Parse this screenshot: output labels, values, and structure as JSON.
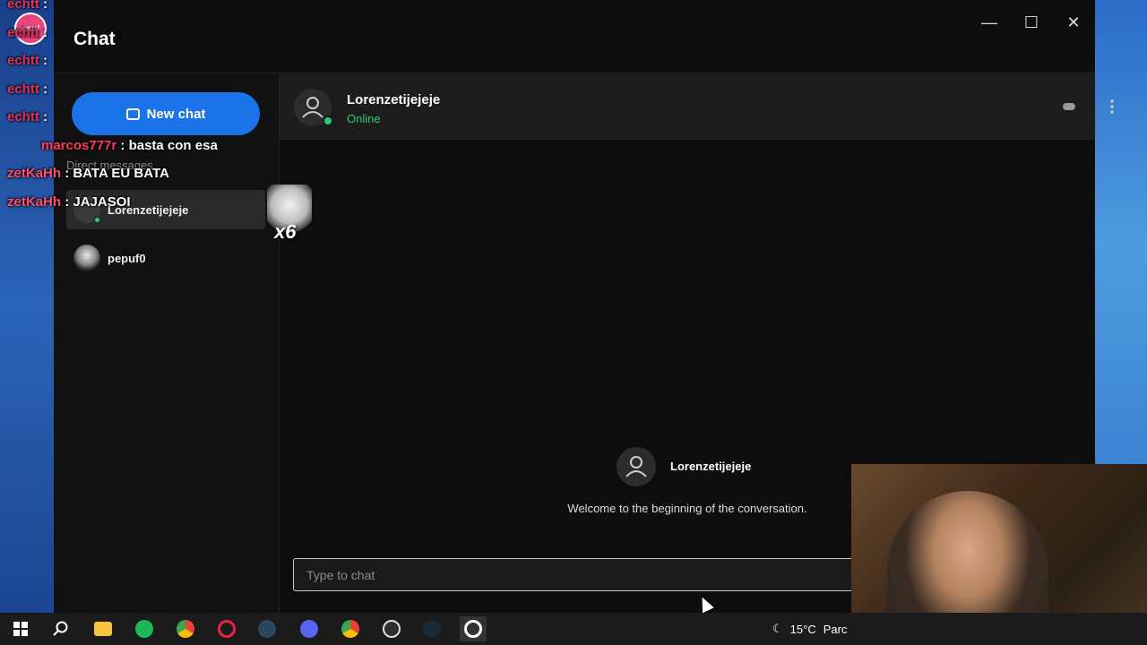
{
  "window": {
    "title": "Chat",
    "controls": {
      "minimize": "—",
      "maximize": "☐",
      "close": "✕"
    }
  },
  "sidebar": {
    "new_chat_label": "New chat",
    "section_heading": "Direct messages",
    "items": [
      {
        "name": "Lorenzetijejeje",
        "online": true,
        "active": true
      },
      {
        "name": "pepuf0",
        "online": false,
        "active": false
      }
    ]
  },
  "chat": {
    "contact_name": "Lorenzetijejeje",
    "contact_status": "Online",
    "welcome_name": "Lorenzetijejeje",
    "welcome_text": "Welcome to the beginning of the conversation.",
    "input_placeholder": "Type to chat",
    "input_value": ""
  },
  "stream_overlay": {
    "badge": "osu!",
    "lines": [
      {
        "user": "echtt",
        "message": ":"
      },
      {
        "user": "echtt",
        "message": ":"
      },
      {
        "user": "echtt",
        "message": ":"
      },
      {
        "user": "echtt",
        "message": ":"
      },
      {
        "user": "echtt",
        "message": ":"
      },
      {
        "user": "marcos777r",
        "message": ": basta con esa"
      },
      {
        "user": "zetKaHh",
        "message": ": BATA EU BATA"
      },
      {
        "user": "zetKaHh",
        "message": ": JAJASOI"
      }
    ],
    "emote_count": "x6"
  },
  "taskbar": {
    "icons": [
      "start-icon",
      "search-icon",
      "file-explorer-icon",
      "spotify-icon",
      "chrome-icon",
      "opera-icon",
      "steam-icon",
      "discord-icon",
      "chrome-icon",
      "obs-icon",
      "steam-icon",
      "osu-icon"
    ],
    "weather": "15°C",
    "weather_desc": "Parc"
  },
  "colors": {
    "accent": "#1a73e8",
    "online": "#2ecc71",
    "window_bg": "#0d0d0d",
    "header_bg": "#1c1c1c"
  }
}
